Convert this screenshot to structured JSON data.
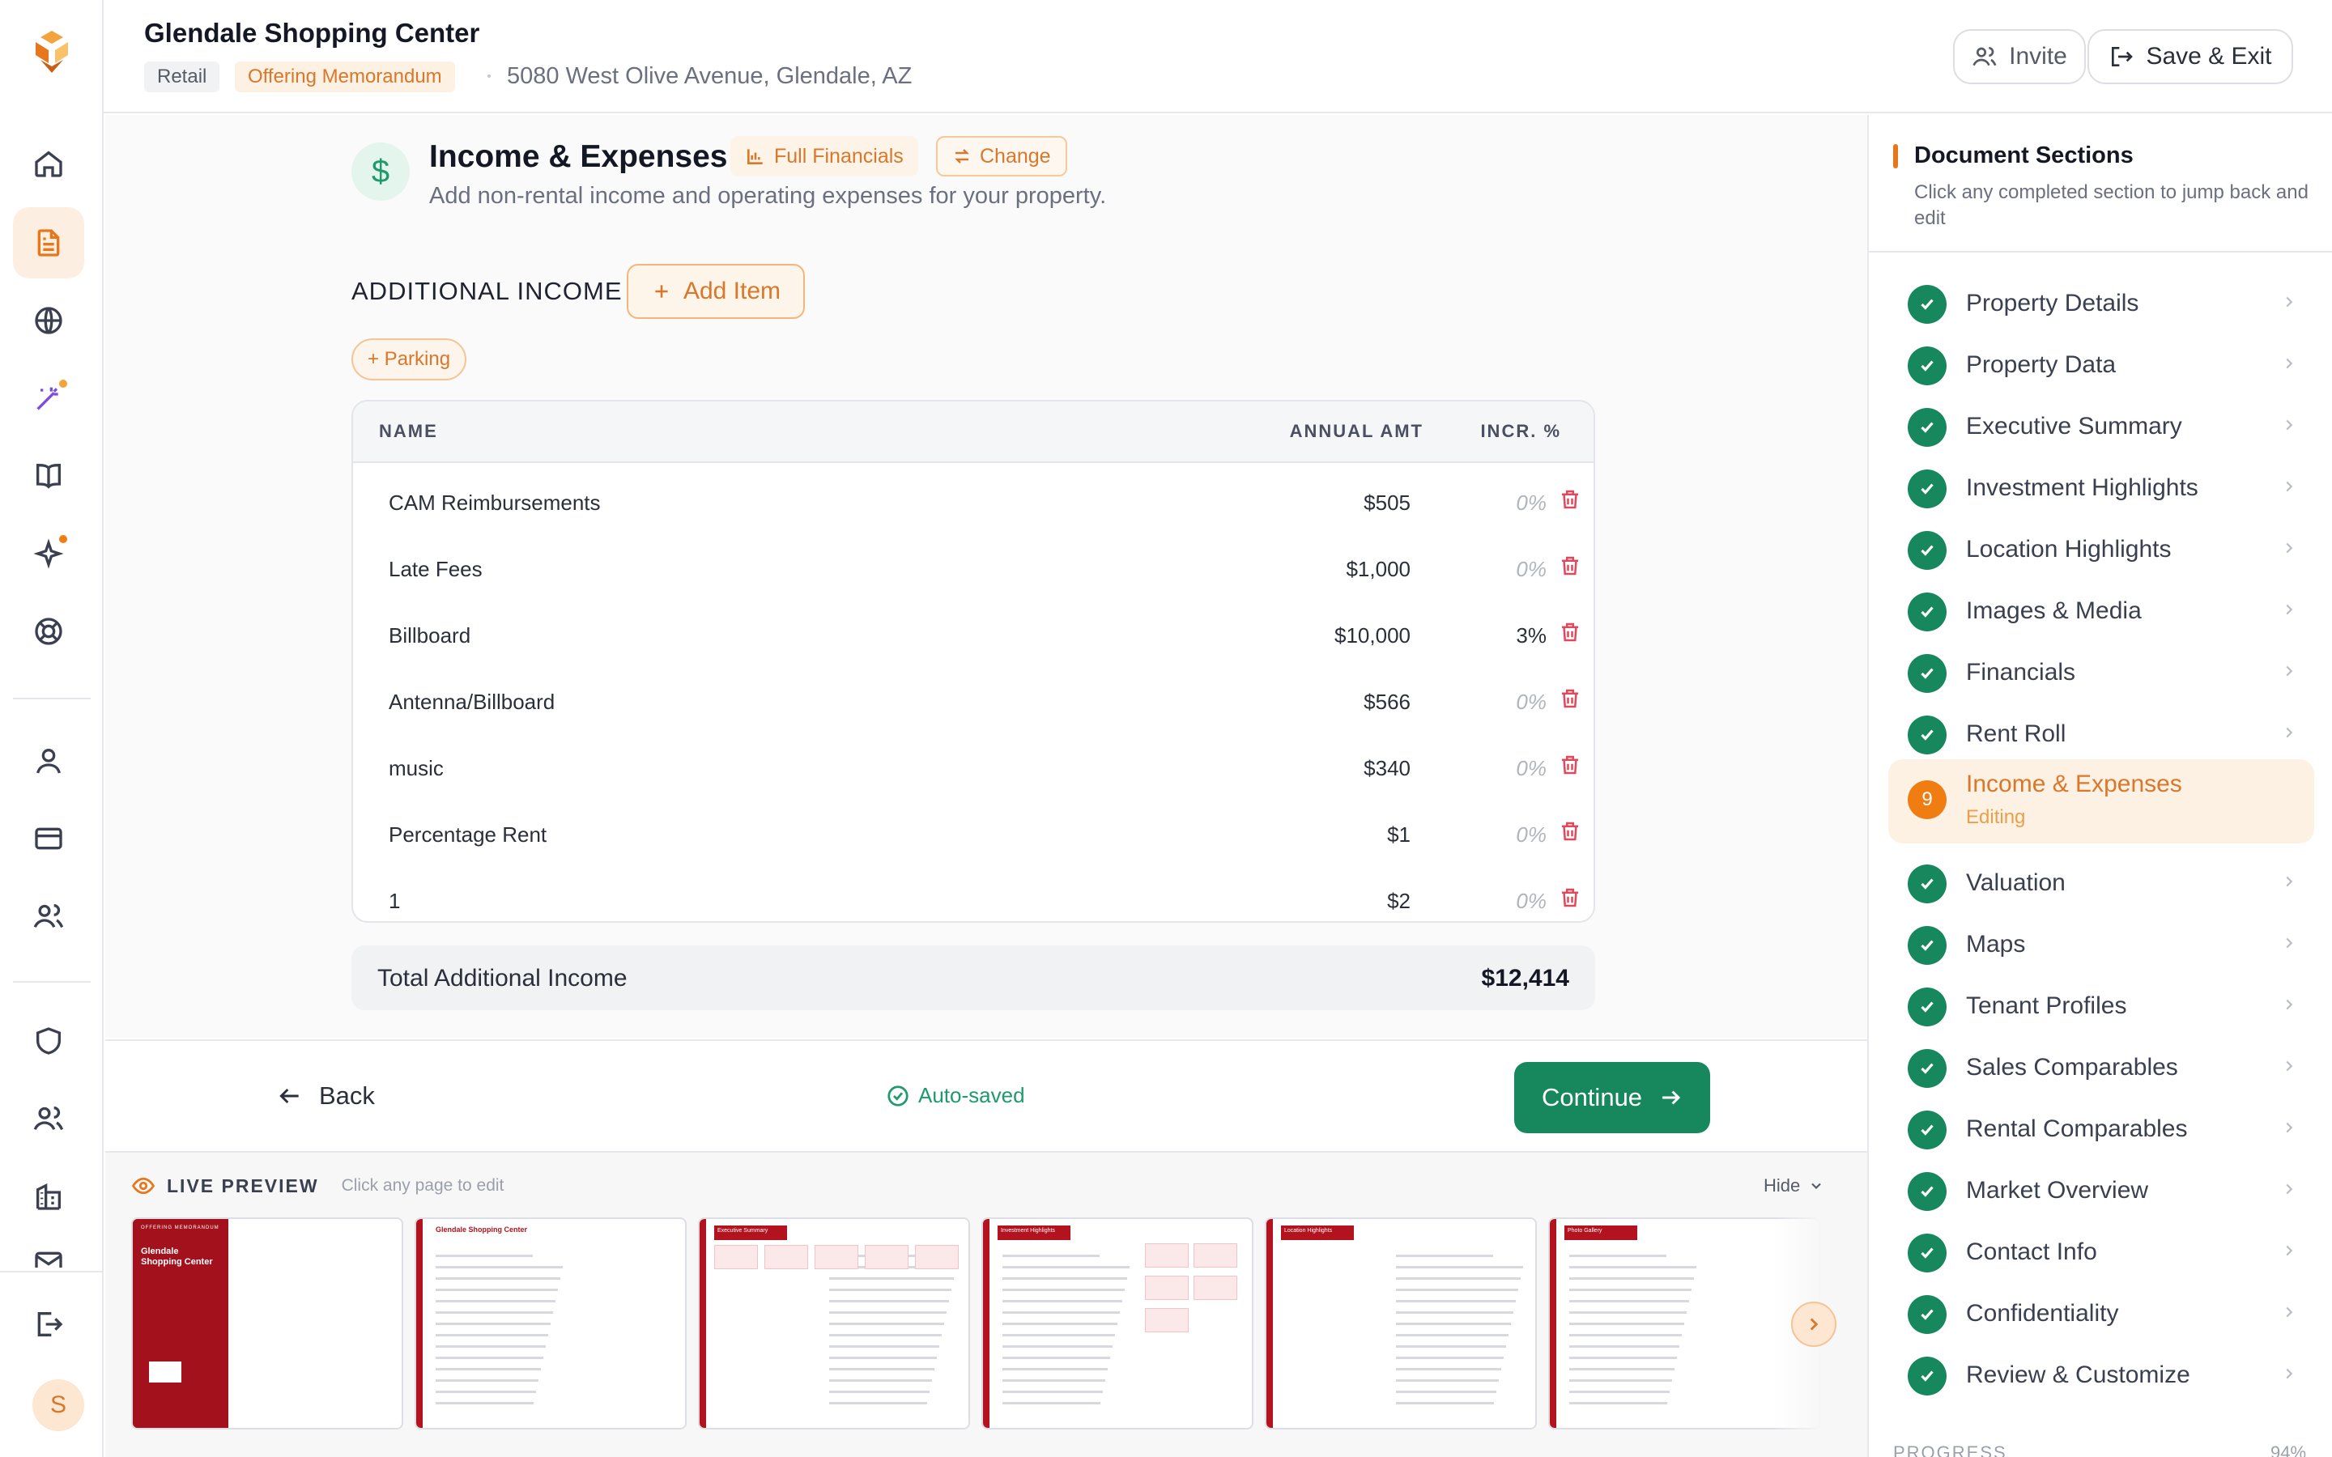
{
  "header": {
    "title": "Glendale Shopping Center",
    "tag_type": "Retail",
    "tag_doc": "Offering Memorandum",
    "address": "5080 West Olive Avenue, Glendale, AZ",
    "invite_label": "Invite",
    "save_label": "Save & Exit"
  },
  "section": {
    "title": "Income & Expenses",
    "mode_label": "Full Financials",
    "change_label": "Change",
    "subtitle": "Add non-rental income and operating expenses for your property.",
    "icon_glyph": "$"
  },
  "additional_income": {
    "label": "ADDITIONAL INCOME",
    "add_label": "Add Item",
    "suggestion": "+ Parking",
    "columns": {
      "name": "NAME",
      "amount": "ANNUAL AMT",
      "increase": "INCR. %"
    },
    "rows": [
      {
        "name": "CAM Reimbursements",
        "amount": "$505",
        "increase": "0%"
      },
      {
        "name": "Late Fees",
        "amount": "$1,000",
        "increase": "0%"
      },
      {
        "name": "Billboard",
        "amount": "$10,000",
        "increase": "3%"
      },
      {
        "name": "Antenna/Billboard",
        "amount": "$566",
        "increase": "0%"
      },
      {
        "name": "music",
        "amount": "$340",
        "increase": "0%"
      },
      {
        "name": "Percentage Rent",
        "amount": "$1",
        "increase": "0%"
      },
      {
        "name": "1",
        "amount": "$2",
        "increase": "0%"
      }
    ],
    "total_label": "Total Additional Income",
    "total_value": "$12,414"
  },
  "footer": {
    "back_label": "Back",
    "autosave_label": "Auto-saved",
    "continue_label": "Continue"
  },
  "preview": {
    "title": "LIVE PREVIEW",
    "hint": "Click any page to edit",
    "hide_label": "Hide",
    "pages": [
      {
        "header": "OFFERING MEMORANDUM",
        "title": "Glendale Shopping Center"
      },
      {
        "header": "",
        "title": "Glendale Shopping Center"
      },
      {
        "header": "Executive Summary",
        "title": ""
      },
      {
        "header": "Investment Highlights",
        "title": ""
      },
      {
        "header": "Location Highlights",
        "title": ""
      },
      {
        "header": "Photo Gallery",
        "title": ""
      }
    ]
  },
  "sidebar": {
    "title": "Document Sections",
    "subtitle": "Click any completed section to jump back and edit",
    "items": [
      {
        "label": "Property Details",
        "status": "done"
      },
      {
        "label": "Property Data",
        "status": "done"
      },
      {
        "label": "Executive Summary",
        "status": "done"
      },
      {
        "label": "Investment Highlights",
        "status": "done"
      },
      {
        "label": "Location Highlights",
        "status": "done"
      },
      {
        "label": "Images & Media",
        "status": "done"
      },
      {
        "label": "Financials",
        "status": "done"
      },
      {
        "label": "Rent Roll",
        "status": "done"
      },
      {
        "label": "Income & Expenses",
        "status": "active",
        "number": "9",
        "status_label": "Editing"
      },
      {
        "label": "Valuation",
        "status": "done"
      },
      {
        "label": "Maps",
        "status": "done"
      },
      {
        "label": "Tenant Profiles",
        "status": "done"
      },
      {
        "label": "Sales Comparables",
        "status": "done"
      },
      {
        "label": "Rental Comparables",
        "status": "done"
      },
      {
        "label": "Market Overview",
        "status": "done"
      },
      {
        "label": "Contact Info",
        "status": "done"
      },
      {
        "label": "Confidentiality",
        "status": "done"
      },
      {
        "label": "Review & Customize",
        "status": "done"
      }
    ],
    "progress_label": "PROGRESS",
    "progress_value": "94%"
  },
  "user": {
    "initial": "S"
  },
  "colors": {
    "accent": "#e8771c",
    "success": "#17875e",
    "danger": "#e0485c",
    "preview_brand": "#b3131f"
  },
  "icons": [
    "home-icon",
    "document-icon",
    "globe-icon",
    "magic-wand-icon",
    "book-icon",
    "sparkles-icon",
    "lifebuoy-icon",
    "user-icon",
    "credit-card-icon",
    "users-icon",
    "shield-icon",
    "team-icon",
    "building-icon",
    "mail-icon",
    "logout-icon"
  ]
}
